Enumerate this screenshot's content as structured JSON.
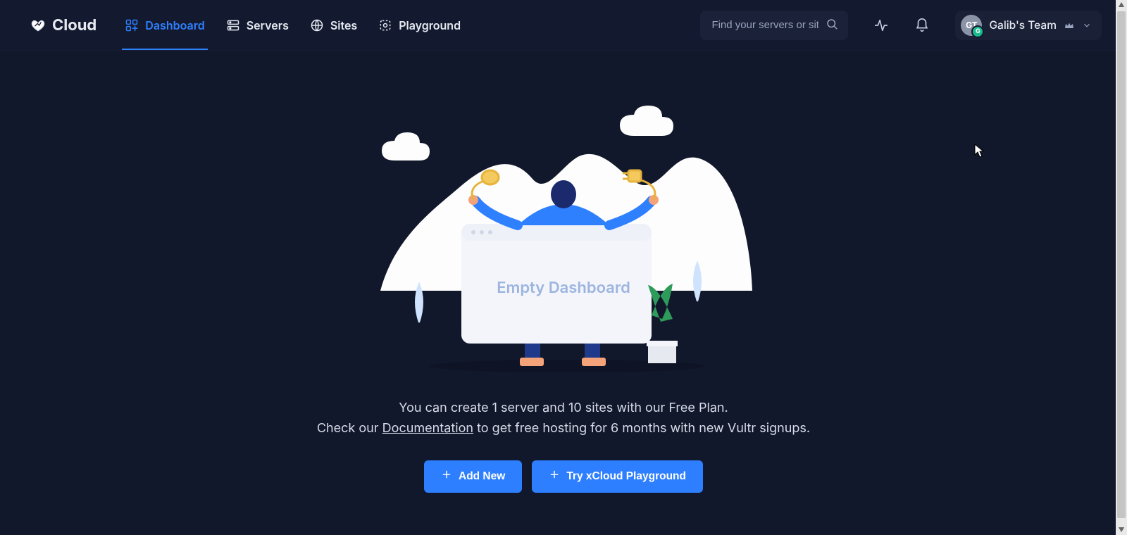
{
  "brand": {
    "name": "Cloud"
  },
  "nav": {
    "items": [
      {
        "label": "Dashboard",
        "active": true
      },
      {
        "label": "Servers",
        "active": false
      },
      {
        "label": "Sites",
        "active": false
      },
      {
        "label": "Playground",
        "active": false
      }
    ]
  },
  "search": {
    "placeholder": "Find your servers or sites"
  },
  "team": {
    "initials": "GT",
    "name": "Galib's Team"
  },
  "empty_state": {
    "illustration_title": "Empty Dashboard",
    "line1": "You can create 1 server and 10 sites with our Free Plan.",
    "line2_pre": "Check our ",
    "line2_link": "Documentation",
    "line2_post": " to get free hosting for 6 months with new Vultr signups.",
    "button_add": "Add New",
    "button_try": "Try xCloud Playground"
  }
}
